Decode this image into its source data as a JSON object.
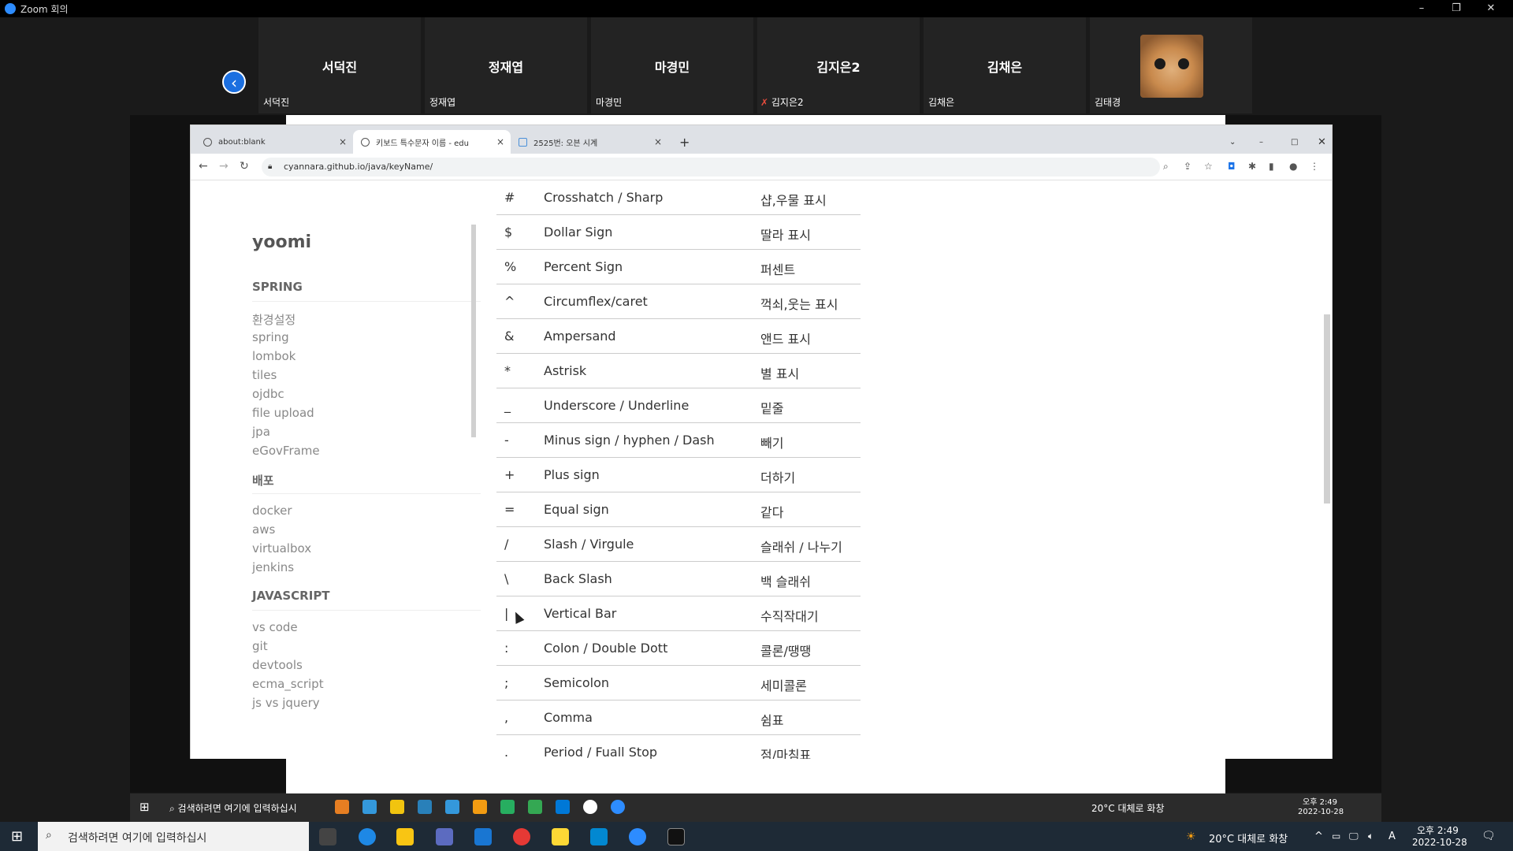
{
  "window": {
    "title": "Zoom 회의"
  },
  "participants": [
    {
      "tile_name": "서덕진",
      "label": "서덕진",
      "muted": false
    },
    {
      "tile_name": "정재엽",
      "label": "정재엽",
      "muted": false
    },
    {
      "tile_name": "마경민",
      "label": "마경민",
      "muted": false
    },
    {
      "tile_name": "김지은2",
      "label": "김지은2",
      "muted": true
    },
    {
      "tile_name": "김채은",
      "label": "김채은",
      "muted": false
    },
    {
      "tile_name": "",
      "label": "김태경",
      "muted": false,
      "video": true
    }
  ],
  "browser": {
    "tabs": [
      {
        "label": "about:blank",
        "active": false
      },
      {
        "label": "키보드 특수문자 이름 - edu",
        "active": true
      },
      {
        "label": "2525번: 오븐 시계",
        "active": false
      }
    ],
    "url": "cyannara.github.io/java/keyName/"
  },
  "sidebar": {
    "brand": "yoomi",
    "sections": [
      {
        "title": "SPRING",
        "items": [
          "환경설정",
          "spring",
          "lombok",
          "tiles",
          "ojdbc",
          "file upload",
          "jpa",
          "eGovFrame"
        ]
      },
      {
        "title": "배포",
        "items": [
          "docker",
          "aws",
          "virtualbox",
          "jenkins"
        ]
      },
      {
        "title": "JAVASCRIPT",
        "items": [
          "vs code",
          "git",
          "devtools",
          "ecma_script",
          "js vs jquery"
        ]
      }
    ]
  },
  "table": {
    "rows": [
      {
        "sym": "#",
        "en": "Crosshatch / Sharp",
        "ko": "샵,우물 표시"
      },
      {
        "sym": "$",
        "en": "Dollar Sign",
        "ko": "딸라 표시"
      },
      {
        "sym": "%",
        "en": "Percent Sign",
        "ko": "퍼센트"
      },
      {
        "sym": "^",
        "en": "Circumflex/caret",
        "ko": "꺽쇠,웃는 표시"
      },
      {
        "sym": "&",
        "en": "Ampersand",
        "ko": "앤드 표시"
      },
      {
        "sym": "*",
        "en": "Astrisk",
        "ko": "별 표시"
      },
      {
        "sym": "_",
        "en": "Underscore / Underline",
        "ko": "밑줄"
      },
      {
        "sym": "-",
        "en": "Minus sign / hyphen / Dash",
        "ko": "빼기"
      },
      {
        "sym": "+",
        "en": "Plus sign",
        "ko": "더하기"
      },
      {
        "sym": "=",
        "en": "Equal sign",
        "ko": "같다"
      },
      {
        "sym": "/",
        "en": "Slash / Virgule",
        "ko": "슬래쉬 / 나누기"
      },
      {
        "sym": "\\",
        "en": "Back Slash",
        "ko": "백 슬래쉬"
      },
      {
        "sym": "|",
        "en": "Vertical Bar",
        "ko": "수직작대기"
      },
      {
        "sym": ":",
        "en": "Colon / Double Dott",
        "ko": "콜론/땡땡"
      },
      {
        "sym": ";",
        "en": "Semicolon",
        "ko": "세미콜론"
      },
      {
        "sym": ",",
        "en": "Comma",
        "ko": "쉼표"
      },
      {
        "sym": ".",
        "en": "Period / Fuall Stop",
        "ko": "점/마침표"
      }
    ]
  },
  "shared_taskbar": {
    "search_placeholder": "검색하려면 여기에 입력하십시",
    "weather": "20°C 대체로 화창",
    "time": "오후 2:49",
    "date": "2022-10-28"
  },
  "taskbar": {
    "search_placeholder": "검색하려면 여기에 입력하십시",
    "weather": "20°C 대체로 화창",
    "time": "오후 2:49",
    "date": "2022-10-28",
    "ime": "A"
  }
}
